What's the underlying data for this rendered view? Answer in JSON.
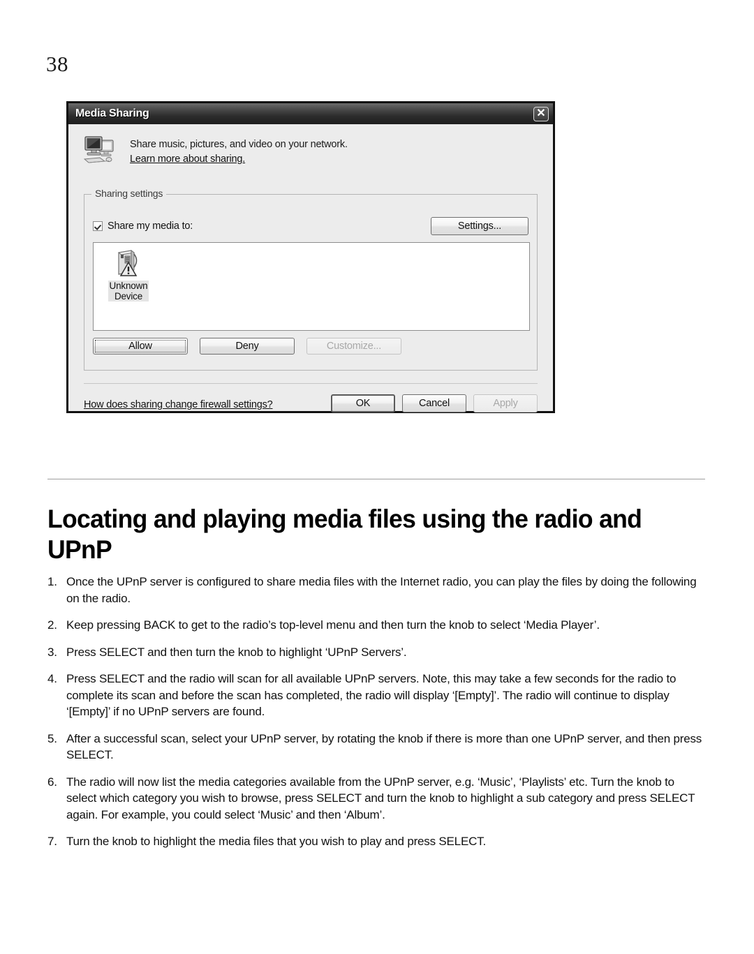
{
  "page": {
    "number": "38"
  },
  "dialog": {
    "title": "Media Sharing",
    "close_icon": "close-icon",
    "computer_icon": "networked-computers-icon",
    "intro_line": "Share music, pictures, and video on your network.",
    "learn_more_link": "Learn more about sharing.",
    "group": {
      "legend": "Sharing settings",
      "share_checkbox_label": "Share my media to:",
      "share_checkbox_checked": true,
      "settings_button": "Settings...",
      "devices": [
        {
          "name": "Unknown\nDevice",
          "name_line1": "Unknown",
          "name_line2": "Device",
          "icon": "unknown-device-warning-icon"
        }
      ],
      "permission_buttons": [
        {
          "label": "Allow",
          "state": "focused"
        },
        {
          "label": "Deny",
          "state": "normal"
        },
        {
          "label": "Customize...",
          "state": "disabled"
        }
      ]
    },
    "firewall_link": "How does sharing change firewall settings?",
    "action_buttons": [
      {
        "label": "OK",
        "state": "default"
      },
      {
        "label": "Cancel",
        "state": "normal"
      },
      {
        "label": "Apply",
        "state": "disabled"
      }
    ]
  },
  "article": {
    "heading": "Locating and playing media files using the radio and UPnP",
    "steps": [
      {
        "num": "1.",
        "text": "Once the UPnP server is configured to share media files with the Internet radio, you can play the files by doing the following on the radio."
      },
      {
        "num": "2.",
        "text": "Keep pressing BACK to get to the radio’s top-level menu and then turn the knob to select ‘Media Player’."
      },
      {
        "num": "3.",
        "text": "Press SELECT and then turn the knob to highlight ‘UPnP Servers’."
      },
      {
        "num": "4.",
        "text": "Press SELECT and the radio will scan for all available UPnP servers. Note, this may take a few seconds for the radio to complete its scan and before the scan has completed, the radio will display ‘[Empty]’. The radio will continue to display ‘[Empty]’ if no UPnP servers are found."
      },
      {
        "num": "5.",
        "text": "After a successful scan, select your UPnP server, by rotating the knob if there is more than one UPnP server, and then press SELECT."
      },
      {
        "num": "6.",
        "text": "The radio will now list the media categories available from the UPnP server, e.g. ‘Music’, ‘Playlists’ etc. Turn the knob to select which category you wish to browse, press SELECT and turn the knob to highlight a sub category and press SELECT again. For example, you could select ‘Music’ and then ‘Album’."
      },
      {
        "num": "7.",
        "text": "Turn the knob to highlight the media files that you wish to play and press SELECT."
      }
    ]
  }
}
